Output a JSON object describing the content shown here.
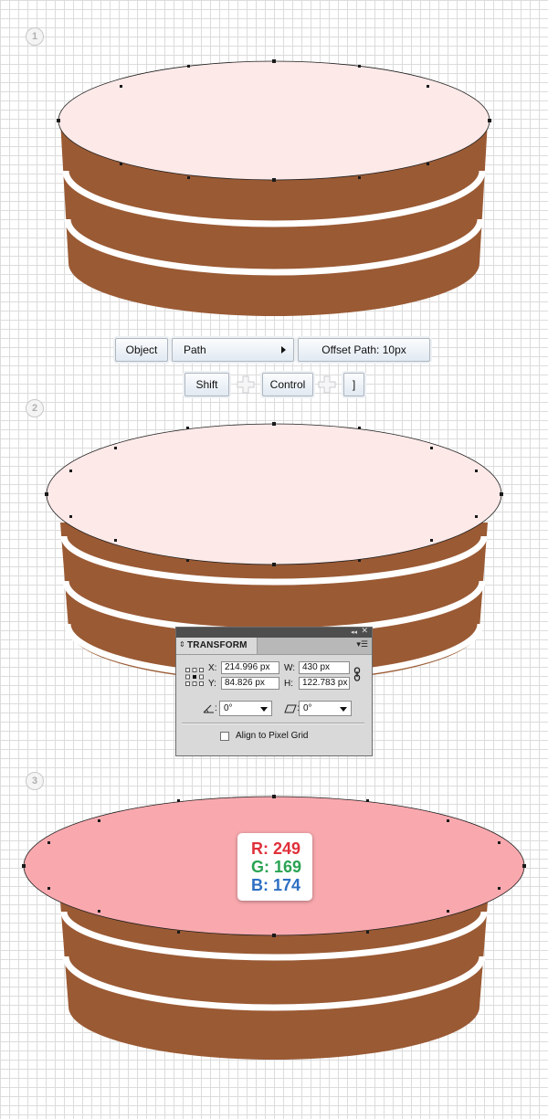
{
  "steps": [
    {
      "number": "1"
    },
    {
      "number": "2"
    },
    {
      "number": "3"
    }
  ],
  "menu_path": {
    "object_label": "Object",
    "path_label": "Path",
    "offset_label": "Offset Path: 10px"
  },
  "shortcut": {
    "shift_label": "Shift",
    "control_label": "Control",
    "bracket_label": "]"
  },
  "transform_panel": {
    "title": "TRANSFORM",
    "x_label": "X:",
    "x_value": "214.996 px",
    "y_label": "Y:",
    "y_value": "84.826 px",
    "w_label": "W:",
    "w_value": "430 px",
    "h_label": "H:",
    "h_value": "122.783 px",
    "rotate_value": "0°",
    "shear_value": "0°",
    "align_label": "Align to Pixel Grid",
    "align_checked": false
  },
  "rgb": {
    "r_text": "R: 249",
    "g_text": "G: 169",
    "b_text": "B: 174",
    "r_color": "#e0303a",
    "g_color": "#2aa352",
    "b_color": "#2d6fc2"
  },
  "colors": {
    "cake_brown": "#9a5a34",
    "cream_top": "#fce9e8",
    "pink_top": "#f9a9ae",
    "stripe": "#ffffff",
    "anchor": "#1a1a1a"
  }
}
